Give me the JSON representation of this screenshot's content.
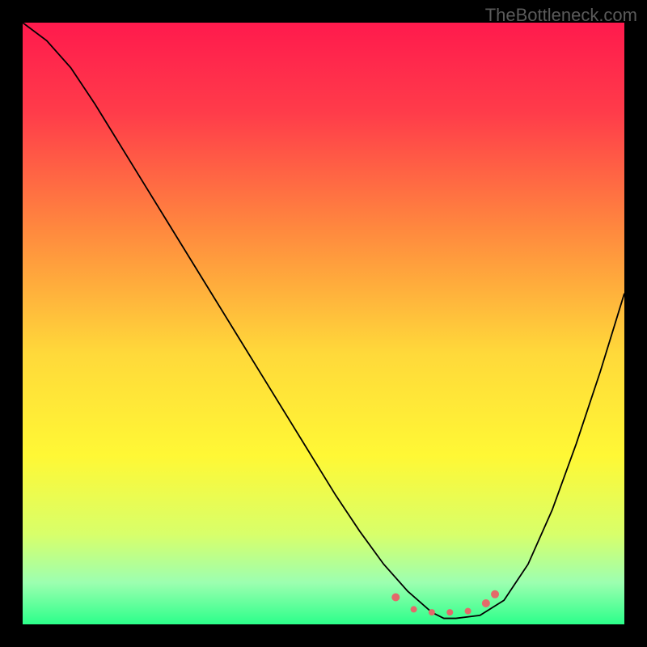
{
  "watermark": "TheBottleneck.com",
  "chart_data": {
    "type": "line",
    "title": "",
    "xlabel": "",
    "ylabel": "",
    "xlim": [
      0,
      100
    ],
    "ylim": [
      0,
      100
    ],
    "background_gradient": {
      "stops": [
        {
          "offset": 0,
          "color": "#ff1a4d"
        },
        {
          "offset": 15,
          "color": "#ff3c4a"
        },
        {
          "offset": 35,
          "color": "#ff8b3e"
        },
        {
          "offset": 55,
          "color": "#ffd93a"
        },
        {
          "offset": 72,
          "color": "#fff835"
        },
        {
          "offset": 85,
          "color": "#d8ff6a"
        },
        {
          "offset": 93,
          "color": "#9dffb0"
        },
        {
          "offset": 100,
          "color": "#2cff8a"
        }
      ]
    },
    "series": [
      {
        "name": "bottleneck-curve",
        "color": "#000000",
        "width": 1.8,
        "x": [
          0,
          4,
          8,
          12,
          16,
          20,
          24,
          28,
          32,
          36,
          40,
          44,
          48,
          52,
          56,
          60,
          64,
          68,
          70,
          72,
          76,
          80,
          84,
          88,
          92,
          96,
          100
        ],
        "y": [
          100,
          97,
          92.5,
          86.5,
          80,
          73.5,
          67,
          60.5,
          54,
          47.5,
          41,
          34.5,
          28,
          21.5,
          15.5,
          10,
          5.5,
          2,
          1,
          1,
          1.5,
          4,
          10,
          19,
          30,
          42,
          55
        ]
      }
    ],
    "highlight": {
      "name": "optimal-range",
      "color": "#e36a6a",
      "points": [
        {
          "x": 62,
          "y": 4.5,
          "r": 5
        },
        {
          "x": 65,
          "y": 2.5,
          "r": 4
        },
        {
          "x": 68,
          "y": 2.0,
          "r": 4
        },
        {
          "x": 71,
          "y": 2.0,
          "r": 4
        },
        {
          "x": 74,
          "y": 2.2,
          "r": 4
        },
        {
          "x": 77,
          "y": 3.5,
          "r": 5
        },
        {
          "x": 78.5,
          "y": 5.0,
          "r": 5
        }
      ]
    }
  }
}
